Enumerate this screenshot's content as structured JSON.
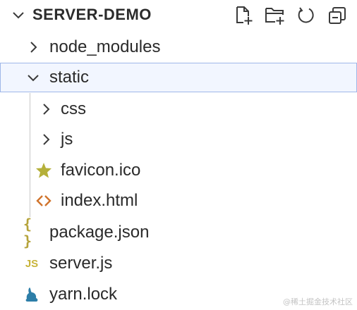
{
  "explorer": {
    "title": "SERVER-DEMO",
    "actions": [
      {
        "name": "new-file",
        "icon": "new-file-icon"
      },
      {
        "name": "new-folder",
        "icon": "new-folder-icon"
      },
      {
        "name": "refresh",
        "icon": "refresh-icon"
      },
      {
        "name": "collapse-all",
        "icon": "collapse-all-icon"
      }
    ],
    "tree": [
      {
        "label": "node_modules",
        "type": "folder",
        "expanded": false,
        "depth": 0
      },
      {
        "label": "static",
        "type": "folder",
        "expanded": true,
        "depth": 0,
        "selected": true
      },
      {
        "label": "css",
        "type": "folder",
        "expanded": false,
        "depth": 1
      },
      {
        "label": "js",
        "type": "folder",
        "expanded": false,
        "depth": 1
      },
      {
        "label": "favicon.ico",
        "type": "file",
        "icon": "favicon-star-icon",
        "depth": 1
      },
      {
        "label": "index.html",
        "type": "file",
        "icon": "html-icon",
        "depth": 1
      },
      {
        "label": "package.json",
        "type": "file",
        "icon": "json-icon",
        "depth": 0
      },
      {
        "label": "server.js",
        "type": "file",
        "icon": "javascript-icon",
        "depth": 0
      },
      {
        "label": "yarn.lock",
        "type": "file",
        "icon": "yarn-icon",
        "depth": 0
      }
    ]
  },
  "colors": {
    "star": "#b5b03a",
    "html": "#d0742c",
    "json": "#b5a33a",
    "js": "#c8b43a",
    "yarn": "#2d7ea8",
    "selection_bg": "#f2f6ff",
    "selection_border": "#9fb7e8"
  },
  "watermark": "@稀土掘金技术社区"
}
